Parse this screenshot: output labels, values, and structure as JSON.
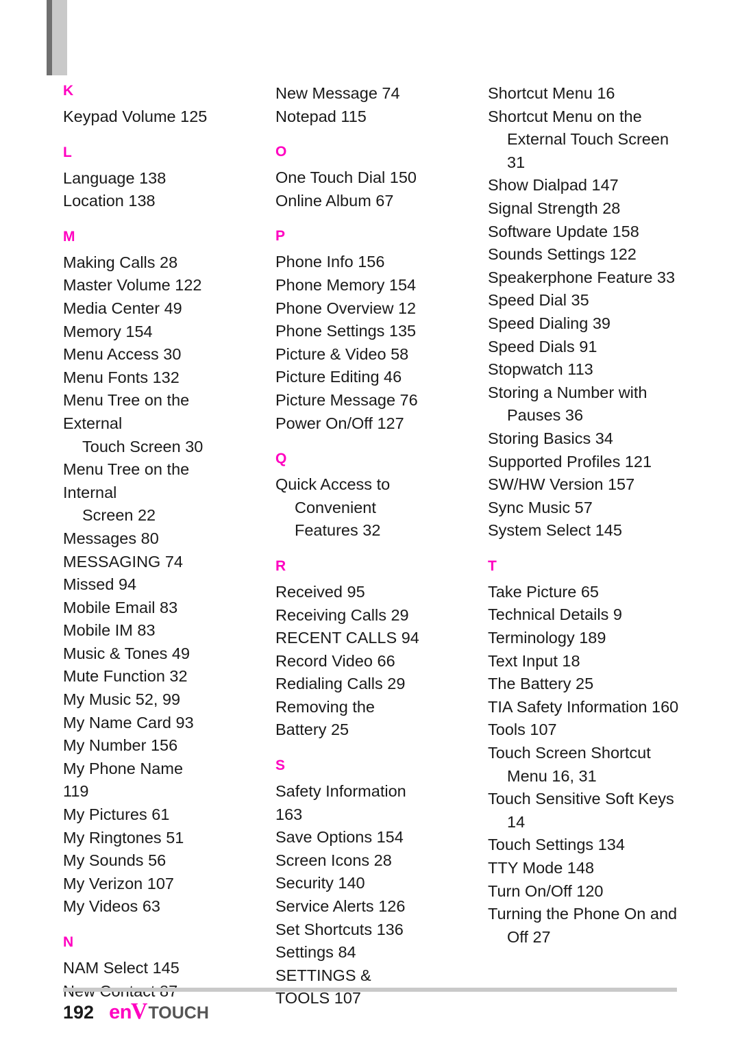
{
  "page": {
    "number": "192",
    "logo_en": "en",
    "logo_v": "V",
    "logo_touch": "TOUCH"
  },
  "columns": [
    {
      "sections": [
        {
          "letter": "K",
          "entries": [
            "Keypad Volume 125"
          ]
        },
        {
          "letter": "L",
          "entries": [
            "Language 138",
            "Location 138"
          ]
        },
        {
          "letter": "M",
          "entries": [
            "Making Calls 28",
            "Master Volume 122",
            "Media Center 49",
            "Memory 154",
            "Menu Access 30",
            "Menu Fonts 132",
            "Menu Tree on the External\nTouch Screen 30",
            "Menu Tree on the Internal\nScreen 22",
            "Messages 80",
            "MESSAGING 74",
            "Missed 94",
            "Mobile Email 83",
            "Mobile IM 83",
            "Music & Tones 49",
            "Mute Function 32",
            "My Music 52, 99",
            "My Name Card 93",
            "My Number 156",
            "My Phone Name 119",
            "My Pictures 61",
            "My Ringtones 51",
            "My Sounds 56",
            "My Verizon 107",
            "My Videos 63"
          ]
        },
        {
          "letter": "N",
          "entries": [
            "NAM Select 145",
            "New Contact 87"
          ]
        }
      ]
    },
    {
      "sections": [
        {
          "letter": "",
          "entries": [
            "New Message 74",
            "Notepad 115"
          ]
        },
        {
          "letter": "O",
          "entries": [
            "One Touch Dial 150",
            "Online Album 67"
          ]
        },
        {
          "letter": "P",
          "entries": [
            "Phone Info 156",
            "Phone Memory 154",
            "Phone Overview 12",
            "Phone Settings 135",
            "Picture & Video 58",
            "Picture Editing 46",
            "Picture Message 76",
            "Power On/Off 127"
          ]
        },
        {
          "letter": "Q",
          "entries": [
            "Quick Access to\nConvenient Features 32"
          ]
        },
        {
          "letter": "R",
          "entries": [
            "Received 95",
            "Receiving Calls 29",
            "RECENT CALLS 94",
            "Record Video 66",
            "Redialing Calls 29",
            "Removing the Battery 25"
          ]
        },
        {
          "letter": "S",
          "entries": [
            "Safety Information 163",
            "Save Options 154",
            "Screen Icons 28",
            "Security 140",
            "Service Alerts 126",
            "Set Shortcuts 136",
            "Settings 84",
            "SETTINGS & TOOLS 107"
          ]
        }
      ]
    },
    {
      "sections": [
        {
          "letter": "",
          "entries": [
            "Shortcut Menu 16",
            "Shortcut Menu on the\nExternal Touch Screen\n31",
            "Show Dialpad 147",
            "Signal Strength 28",
            "Software Update 158",
            "Sounds Settings 122",
            "Speakerphone Feature 33",
            "Speed Dial 35",
            "Speed Dialing 39",
            "Speed Dials 91",
            "Stopwatch 113",
            "Storing a Number with\nPauses 36",
            "Storing Basics 34",
            "Supported Profiles 121",
            "SW/HW Version 157",
            "Sync Music 57",
            "System Select 145"
          ]
        },
        {
          "letter": "T",
          "entries": [
            "Take Picture 65",
            "Technical Details 9",
            "Terminology 189",
            "Text Input 18",
            "The Battery 25",
            "TIA Safety Information 160",
            "Tools 107",
            "Touch Screen Shortcut\nMenu 16, 31",
            "Touch Sensitive Soft Keys\n14",
            "Touch Settings 134",
            "TTY Mode 148",
            "Turn On/Off 120",
            "Turning the Phone On and\nOff 27"
          ]
        }
      ]
    }
  ]
}
